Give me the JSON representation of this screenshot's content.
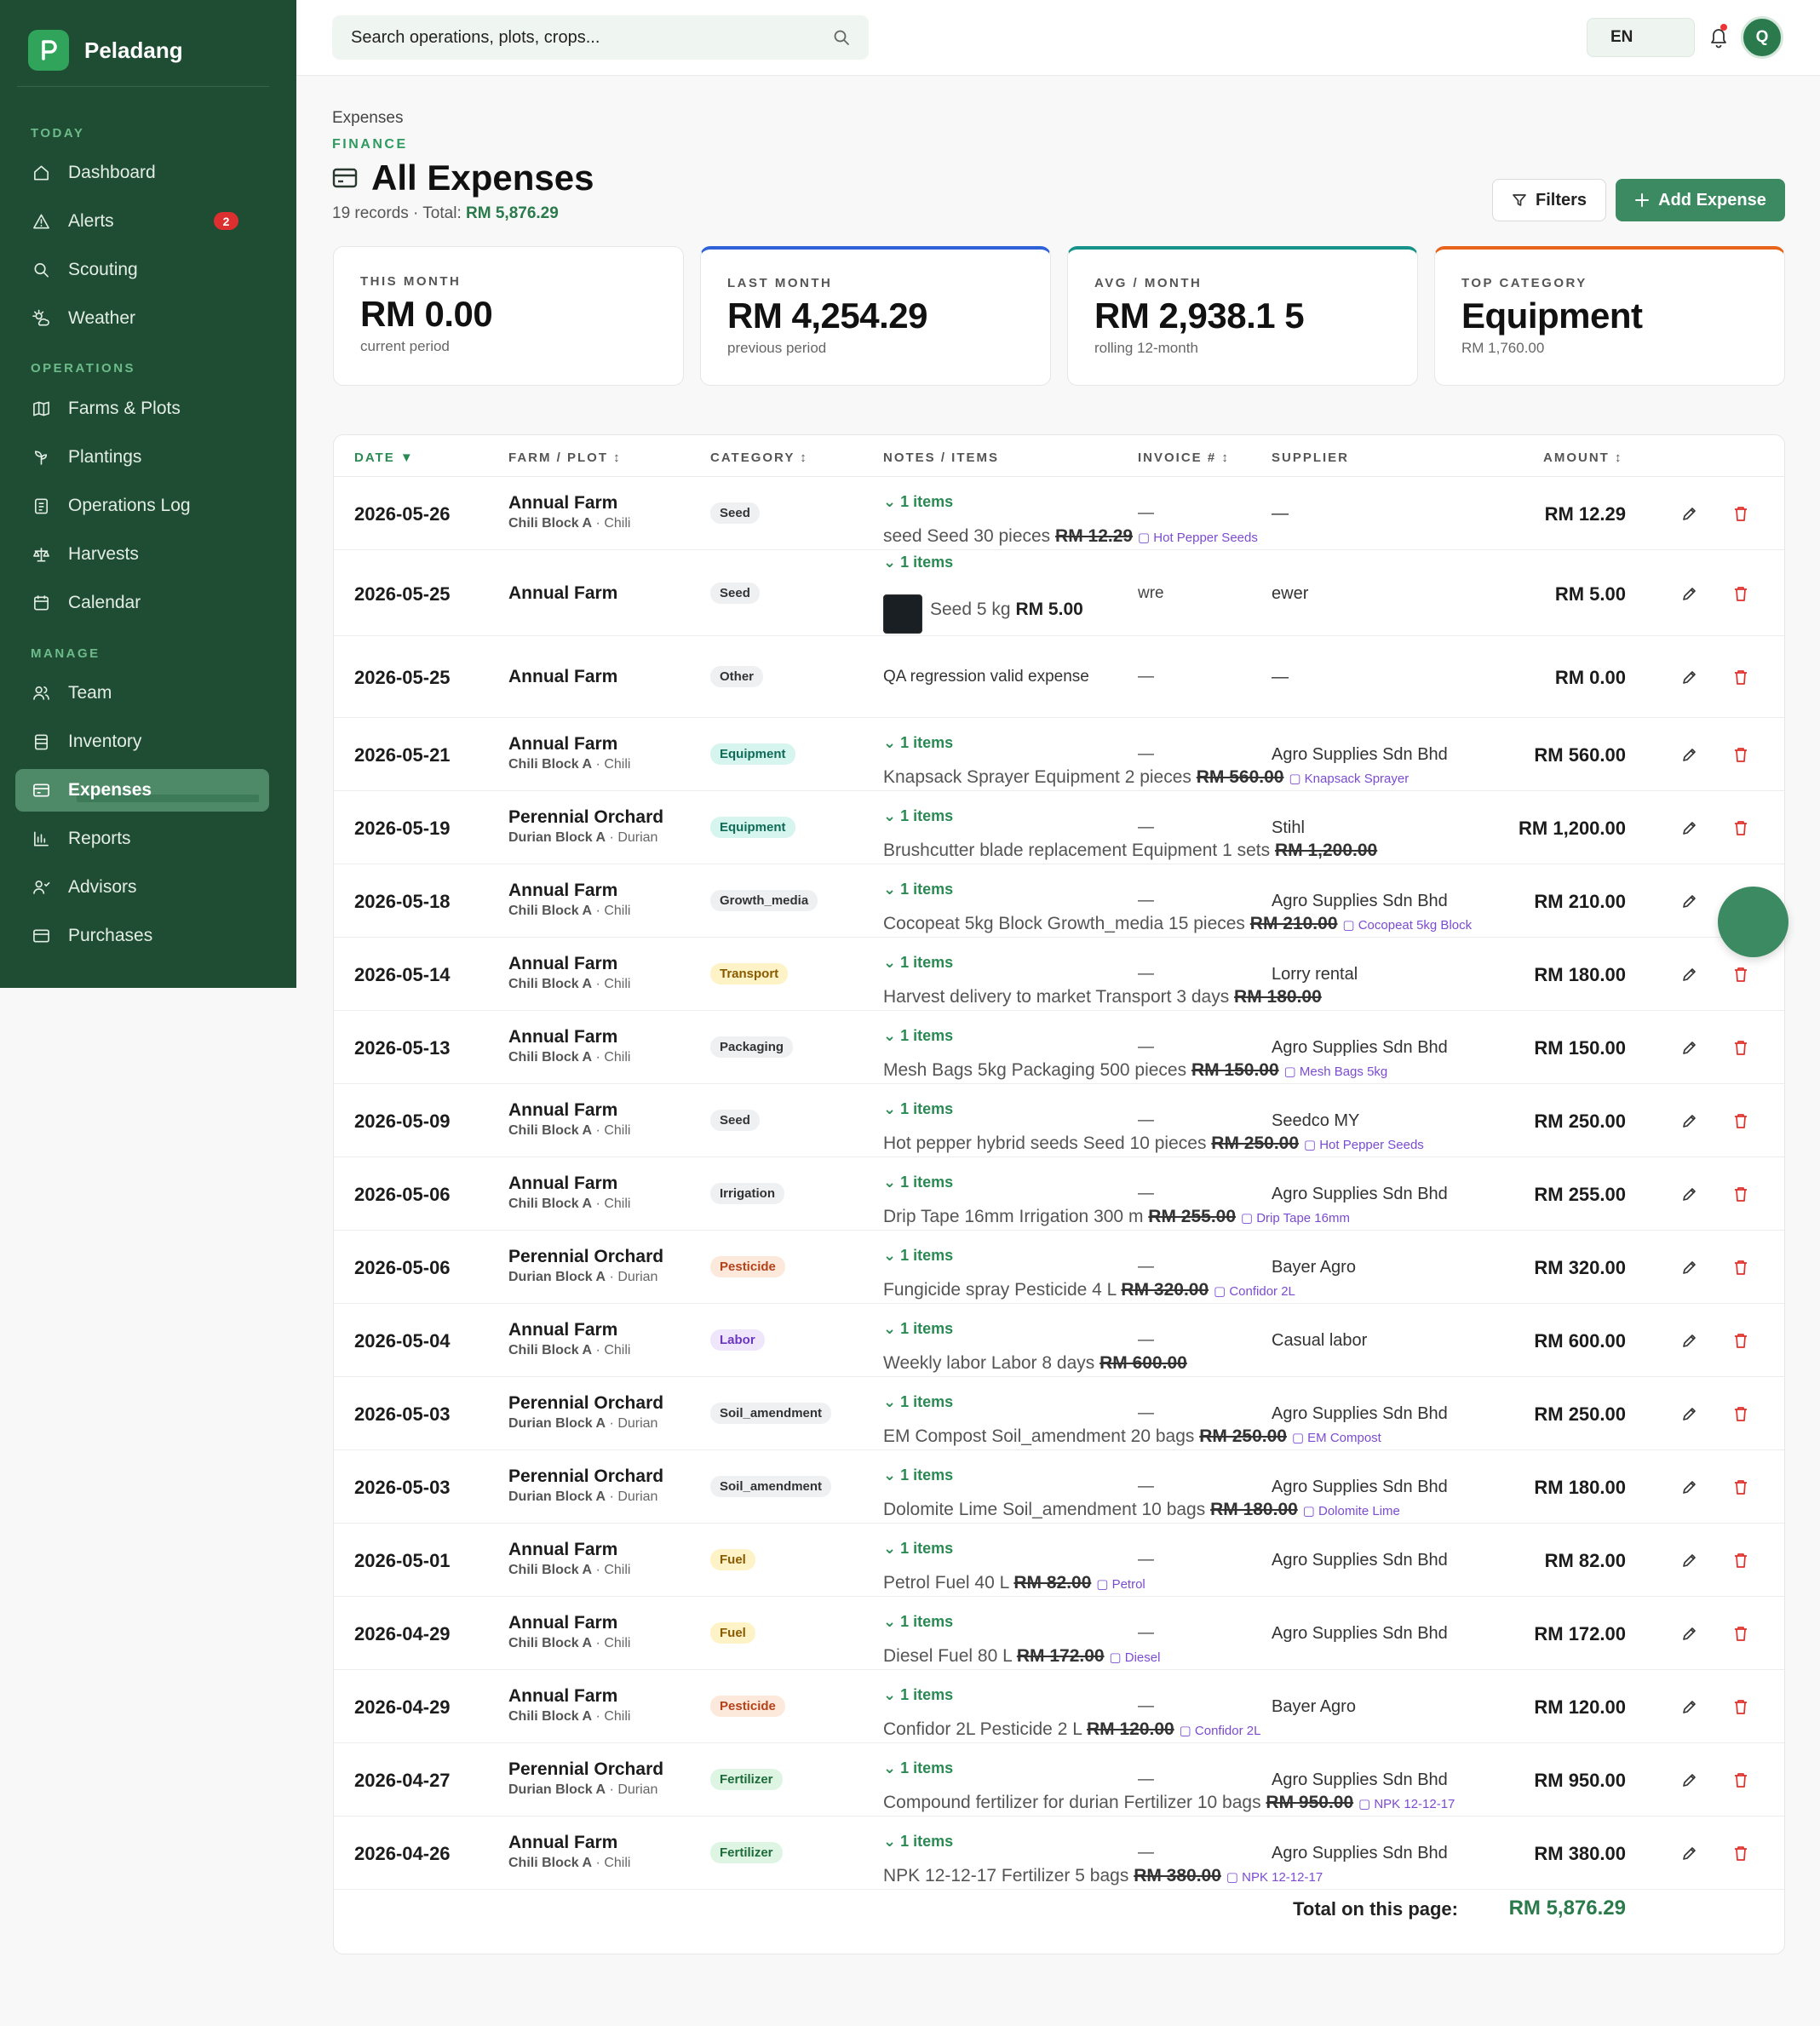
{
  "app": {
    "name": "Peladang",
    "logo_letter": "P"
  },
  "search": {
    "placeholder": "Search operations, plots, crops..."
  },
  "topbar": {
    "language": "EN",
    "avatar_initial": "Q"
  },
  "sidebar": {
    "sections": [
      "TODAY",
      "OPERATIONS",
      "MANAGE"
    ],
    "items": [
      {
        "label": "Dashboard",
        "icon": "home-icon"
      },
      {
        "label": "Alerts",
        "icon": "warning-icon",
        "badge": "2"
      },
      {
        "label": "Scouting",
        "icon": "search-icon"
      },
      {
        "label": "Weather",
        "icon": "weather-icon"
      },
      {
        "label": "Farms & Plots",
        "icon": "map-icon"
      },
      {
        "label": "Plantings",
        "icon": "sprout-icon"
      },
      {
        "label": "Operations Log",
        "icon": "clipboard-icon"
      },
      {
        "label": "Harvests",
        "icon": "scale-icon"
      },
      {
        "label": "Calendar",
        "icon": "calendar-icon"
      },
      {
        "label": "Team",
        "icon": "users-icon"
      },
      {
        "label": "Inventory",
        "icon": "box-icon"
      },
      {
        "label": "Expenses",
        "icon": "wallet-icon",
        "active": true
      },
      {
        "label": "Reports",
        "icon": "chart-icon"
      },
      {
        "label": "Advisors",
        "icon": "advisors-icon"
      },
      {
        "label": "Purchases",
        "icon": "card-icon"
      }
    ]
  },
  "page": {
    "breadcrumb": "Expenses",
    "eyebrow": "FINANCE",
    "title": "All Expenses",
    "subtitle_prefix": "19 records · Total: ",
    "subtitle_total": "RM 5,876.29",
    "filters_label": "Filters",
    "add_label": "Add Expense"
  },
  "stats": [
    {
      "key": "THIS MONTH",
      "value": "RM 0.00",
      "sub": "current period",
      "accent": ""
    },
    {
      "key": "LAST MONTH",
      "value": "RM 4,254.29",
      "sub": "previous period",
      "accent": "#2f62d8"
    },
    {
      "key": "AVG / MONTH",
      "value": "RM 2,938.1 5",
      "sub": "rolling 12-month",
      "accent": "#17938a"
    },
    {
      "key": "TOP CATEGORY",
      "value": "Equipment",
      "sub": "RM 1,760.00",
      "accent": "#e8631c"
    }
  ],
  "table": {
    "headers": {
      "date": "DATE ▼",
      "farm": "FARM / PLOT ↕",
      "category": "CATEGORY ↕",
      "notes": "NOTES / ITEMS",
      "invoice": "INVOICE # ↕",
      "supplier": "SUPPLIER",
      "amount": "AMOUNT ↕"
    },
    "items_label": "1 items",
    "rows": [
      {
        "date": "2026-05-26",
        "farm": "Annual Farm",
        "plot": "Chili Block A",
        "crop": "Chili",
        "category": "Seed",
        "invoice": "—",
        "supplier": "—",
        "amount": "RM 12.29",
        "item": {
          "name": "seed",
          "cat": "Seed",
          "qty": "30 pieces",
          "price": "RM 12.29",
          "inv": "Hot Pepper Seeds"
        }
      },
      {
        "date": "2026-05-25",
        "farm": "Annual Farm",
        "plot": "",
        "crop": "",
        "category": "Seed",
        "invoice": "wre",
        "supplier": "ewer",
        "amount": "RM 5.00",
        "thumb": true,
        "item": {
          "name": "",
          "cat": "Seed",
          "qty": "5 kg",
          "price": "RM 5.00",
          "inv": ""
        }
      },
      {
        "date": "2026-05-25",
        "farm": "Annual Farm",
        "plot": "",
        "crop": "",
        "category": "Other",
        "invoice": "—",
        "supplier": "—",
        "amount": "RM 0.00",
        "note": "QA regression valid expense"
      },
      {
        "date": "2026-05-21",
        "farm": "Annual Farm",
        "plot": "Chili Block A",
        "crop": "Chili",
        "category": "Equipment",
        "invoice": "—",
        "supplier": "Agro Supplies Sdn Bhd",
        "amount": "RM 560.00",
        "item": {
          "name": "Knapsack Sprayer",
          "cat": "Equipment",
          "qty": "2 pieces",
          "price": "RM 560.00",
          "inv": "Knapsack Sprayer"
        }
      },
      {
        "date": "2026-05-19",
        "farm": "Perennial Orchard",
        "plot": "Durian Block A",
        "crop": "Durian",
        "category": "Equipment",
        "invoice": "—",
        "supplier": "Stihl",
        "amount": "RM 1,200.00",
        "item": {
          "name": "Brushcutter blade replacement",
          "cat": "Equipment",
          "qty": "1 sets",
          "price": "RM 1,200.00",
          "inv": ""
        }
      },
      {
        "date": "2026-05-18",
        "farm": "Annual Farm",
        "plot": "Chili Block A",
        "crop": "Chili",
        "category": "Growth_media",
        "invoice": "—",
        "supplier": "Agro Supplies Sdn Bhd",
        "amount": "RM 210.00",
        "item": {
          "name": "Cocopeat 5kg Block",
          "cat": "Growth_media",
          "qty": "15 pieces",
          "price": "RM 210.00",
          "inv": "Cocopeat 5kg Block"
        }
      },
      {
        "date": "2026-05-14",
        "farm": "Annual Farm",
        "plot": "Chili Block A",
        "crop": "Chili",
        "category": "Transport",
        "invoice": "—",
        "supplier": "Lorry rental",
        "amount": "RM 180.00",
        "item": {
          "name": "Harvest delivery to market",
          "cat": "Transport",
          "qty": "3 days",
          "price": "RM 180.00",
          "inv": ""
        }
      },
      {
        "date": "2026-05-13",
        "farm": "Annual Farm",
        "plot": "Chili Block A",
        "crop": "Chili",
        "category": "Packaging",
        "invoice": "—",
        "supplier": "Agro Supplies Sdn Bhd",
        "amount": "RM 150.00",
        "item": {
          "name": "Mesh Bags 5kg",
          "cat": "Packaging",
          "qty": "500 pieces",
          "price": "RM 150.00",
          "inv": "Mesh Bags 5kg"
        }
      },
      {
        "date": "2026-05-09",
        "farm": "Annual Farm",
        "plot": "Chili Block A",
        "crop": "Chili",
        "category": "Seed",
        "invoice": "—",
        "supplier": "Seedco MY",
        "amount": "RM 250.00",
        "item": {
          "name": "Hot pepper hybrid seeds",
          "cat": "Seed",
          "qty": "10 pieces",
          "price": "RM 250.00",
          "inv": "Hot Pepper Seeds"
        }
      },
      {
        "date": "2026-05-06",
        "farm": "Annual Farm",
        "plot": "Chili Block A",
        "crop": "Chili",
        "category": "Irrigation",
        "invoice": "—",
        "supplier": "Agro Supplies Sdn Bhd",
        "amount": "RM 255.00",
        "item": {
          "name": "Drip Tape 16mm",
          "cat": "Irrigation",
          "qty": "300 m",
          "price": "RM 255.00",
          "inv": "Drip Tape 16mm"
        }
      },
      {
        "date": "2026-05-06",
        "farm": "Perennial Orchard",
        "plot": "Durian Block A",
        "crop": "Durian",
        "category": "Pesticide",
        "invoice": "—",
        "supplier": "Bayer Agro",
        "amount": "RM 320.00",
        "item": {
          "name": "Fungicide spray",
          "cat": "Pesticide",
          "qty": "4 L",
          "price": "RM 320.00",
          "inv": "Confidor 2L"
        }
      },
      {
        "date": "2026-05-04",
        "farm": "Annual Farm",
        "plot": "Chili Block A",
        "crop": "Chili",
        "category": "Labor",
        "invoice": "—",
        "supplier": "Casual labor",
        "amount": "RM 600.00",
        "item": {
          "name": "Weekly labor",
          "cat": "Labor",
          "qty": "8 days",
          "price": "RM 600.00",
          "inv": ""
        }
      },
      {
        "date": "2026-05-03",
        "farm": "Perennial Orchard",
        "plot": "Durian Block A",
        "crop": "Durian",
        "category": "Soil_amendment",
        "invoice": "—",
        "supplier": "Agro Supplies Sdn Bhd",
        "amount": "RM 250.00",
        "item": {
          "name": "EM Compost",
          "cat": "Soil_amendment",
          "qty": "20 bags",
          "price": "RM 250.00",
          "inv": "EM Compost"
        }
      },
      {
        "date": "2026-05-03",
        "farm": "Perennial Orchard",
        "plot": "Durian Block A",
        "crop": "Durian",
        "category": "Soil_amendment",
        "invoice": "—",
        "supplier": "Agro Supplies Sdn Bhd",
        "amount": "RM 180.00",
        "item": {
          "name": "Dolomite Lime",
          "cat": "Soil_amendment",
          "qty": "10 bags",
          "price": "RM 180.00",
          "inv": "Dolomite Lime"
        }
      },
      {
        "date": "2026-05-01",
        "farm": "Annual Farm",
        "plot": "Chili Block A",
        "crop": "Chili",
        "category": "Fuel",
        "invoice": "—",
        "supplier": "Agro Supplies Sdn Bhd",
        "amount": "RM 82.00",
        "item": {
          "name": "Petrol",
          "cat": "Fuel",
          "qty": "40 L",
          "price": "RM 82.00",
          "inv": "Petrol"
        }
      },
      {
        "date": "2026-04-29",
        "farm": "Annual Farm",
        "plot": "Chili Block A",
        "crop": "Chili",
        "category": "Fuel",
        "invoice": "—",
        "supplier": "Agro Supplies Sdn Bhd",
        "amount": "RM 172.00",
        "item": {
          "name": "Diesel",
          "cat": "Fuel",
          "qty": "80 L",
          "price": "RM 172.00",
          "inv": "Diesel"
        }
      },
      {
        "date": "2026-04-29",
        "farm": "Annual Farm",
        "plot": "Chili Block A",
        "crop": "Chili",
        "category": "Pesticide",
        "invoice": "—",
        "supplier": "Bayer Agro",
        "amount": "RM 120.00",
        "item": {
          "name": "Confidor 2L",
          "cat": "Pesticide",
          "qty": "2 L",
          "price": "RM 120.00",
          "inv": "Confidor 2L"
        }
      },
      {
        "date": "2026-04-27",
        "farm": "Perennial Orchard",
        "plot": "Durian Block A",
        "crop": "Durian",
        "category": "Fertilizer",
        "invoice": "—",
        "supplier": "Agro Supplies Sdn Bhd",
        "amount": "RM 950.00",
        "item": {
          "name": "Compound fertilizer for durian",
          "cat": "Fertilizer",
          "qty": "10 bags",
          "price": "RM 950.00",
          "inv": "NPK 12-12-17"
        }
      },
      {
        "date": "2026-04-26",
        "farm": "Annual Farm",
        "plot": "Chili Block A",
        "crop": "Chili",
        "category": "Fertilizer",
        "invoice": "—",
        "supplier": "Agro Supplies Sdn Bhd",
        "amount": "RM 380.00",
        "item": {
          "name": "NPK 12-12-17",
          "cat": "Fertilizer",
          "qty": "5 bags",
          "price": "RM 380.00",
          "inv": "NPK 12-12-17"
        }
      }
    ],
    "total_label": "Total on this page:",
    "total_value": "RM 5,876.29"
  },
  "tag_colors": {
    "Seed": [
      "#eef0f2",
      "#333"
    ],
    "Other": [
      "#eef0f2",
      "#333"
    ],
    "Equipment": [
      "#d6f5ee",
      "#0f6b57"
    ],
    "Growth_media": [
      "#eef0f2",
      "#333"
    ],
    "Transport": [
      "#fdf3c7",
      "#8a5a00"
    ],
    "Packaging": [
      "#eef0f2",
      "#333"
    ],
    "Irrigation": [
      "#eef0f2",
      "#333"
    ],
    "Pesticide": [
      "#fde9dc",
      "#b3421a"
    ],
    "Labor": [
      "#efe6fc",
      "#6b36c2"
    ],
    "Soil_amendment": [
      "#eef0f2",
      "#333"
    ],
    "Fuel": [
      "#fdf3c7",
      "#8a5a00"
    ],
    "Fertilizer": [
      "#def5e4",
      "#1d6b3a"
    ]
  }
}
